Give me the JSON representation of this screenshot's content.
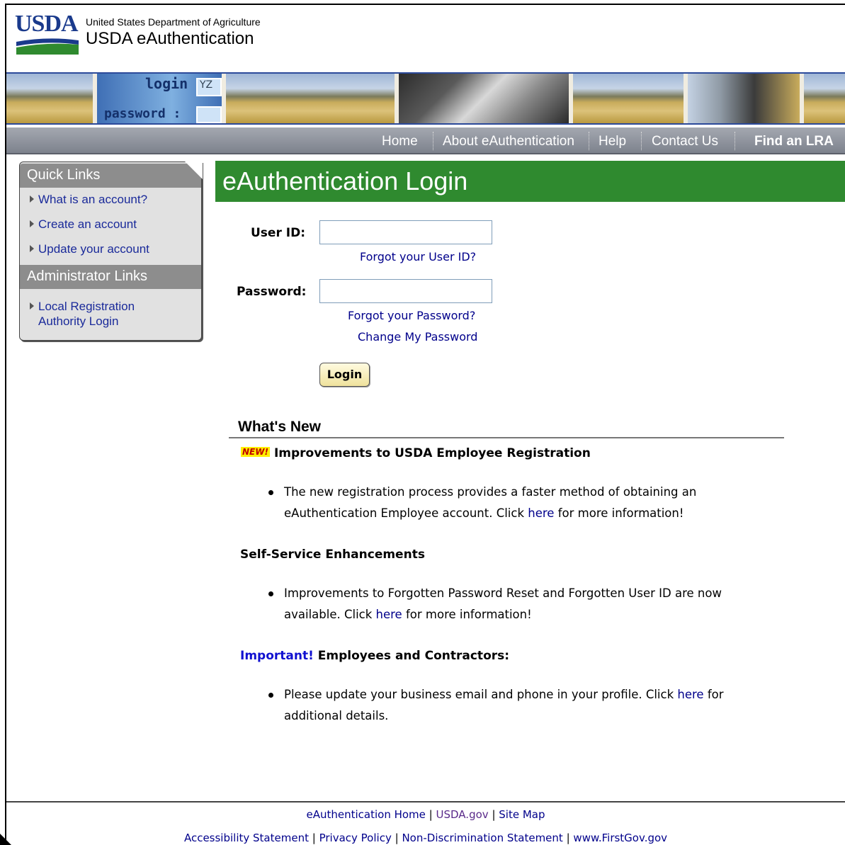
{
  "header": {
    "logo_text": "USDA",
    "department": "United States Department of Agriculture",
    "app_name": "USDA eAuthentication"
  },
  "banner": {
    "login_word": "login :",
    "password_word": "password :",
    "box_text": "YZ"
  },
  "nav": {
    "items": [
      "Home",
      "About eAuthentication",
      "Help",
      "Contact Us",
      "Find an LRA"
    ]
  },
  "sidebar": {
    "quick_links_title": "Quick Links",
    "quick_links": [
      "What is an account?",
      "Create an account",
      "Update your account"
    ],
    "admin_title": "Administrator Links",
    "admin_link_line1": "Local Registration",
    "admin_link_line2": "Authority Login"
  },
  "login": {
    "title": "eAuthentication Login",
    "user_id_label": "User ID:",
    "user_id_value": "",
    "forgot_user_id": "Forgot your User ID?",
    "password_label": "Password:",
    "password_value": "",
    "forgot_password": "Forgot your Password?",
    "change_password": "Change My Password",
    "login_button": "Login"
  },
  "whats_new": {
    "heading": "What's New",
    "new_badge": "NEW!",
    "item1_heading": "Improvements to USDA Employee Registration",
    "item1_line1": "The new registration process provides a faster method of obtaining an",
    "item1_line2_pre": "eAuthentication Employee account. Click ",
    "item1_link": "here",
    "item1_line2_post": " for more information!",
    "item2_heading": "Self-Service Enhancements",
    "item2_line1": "Improvements to Forgotten Password Reset and Forgotten User ID are now",
    "item2_line2_pre": "available. Click ",
    "item2_link": "here",
    "item2_line2_post": " for more information!",
    "item3_important": "Important!",
    "item3_heading": " Employees and Contractors:",
    "item3_line1_pre": "Please update your business email and phone in your profile. Click ",
    "item3_link": "here",
    "item3_line1_post": " for",
    "item3_line2": "additional details."
  },
  "footer": {
    "row1": [
      "eAuthentication Home",
      "USDA.gov",
      "Site Map"
    ],
    "row2": [
      "Accessibility Statement",
      "Privacy Policy",
      "Non-Discrimination Statement",
      "www.FirstGov.gov"
    ],
    "separator": "|"
  },
  "colors": {
    "title_green": "#2f8a2f",
    "nav_gray": "#8d929b",
    "link_blue": "#00008b",
    "usda_blue": "#1a3a8c"
  }
}
